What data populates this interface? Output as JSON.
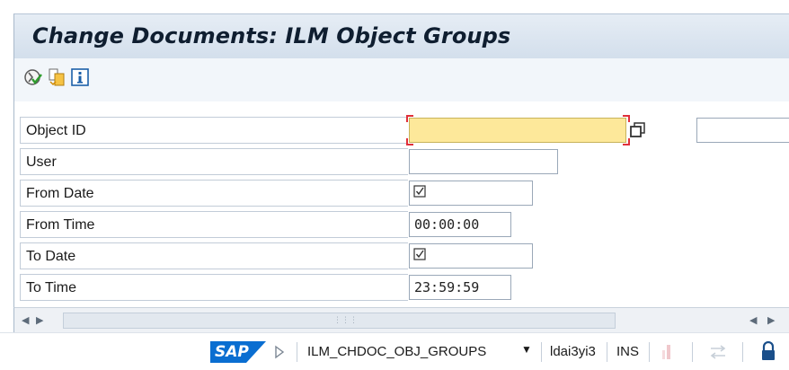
{
  "window": {
    "title": "Change Documents: ILM Object Groups"
  },
  "toolbar": {
    "buttons": [
      {
        "icon": "execute-icon"
      },
      {
        "icon": "get-variant-icon"
      },
      {
        "icon": "information-icon"
      }
    ]
  },
  "form": {
    "fields": [
      {
        "label": "Object ID",
        "value": ""
      },
      {
        "label": "User",
        "value": ""
      },
      {
        "label": "From Date",
        "value": ""
      },
      {
        "label": "From Time",
        "value": "00:00:00"
      },
      {
        "label": "To Date",
        "value": ""
      },
      {
        "label": "To Time",
        "value": "23:59:59"
      }
    ]
  },
  "statusbar": {
    "logo": "SAP",
    "transaction": "ILM_CHDOC_OBJ_GROUPS",
    "server": "ldai3yi3",
    "mode": "INS"
  },
  "colors": {
    "title_bg": "#dbe5f0",
    "focused_input": "#fde89a",
    "focus_marker": "#e0303a",
    "sap_blue": "#0a6ed1"
  }
}
